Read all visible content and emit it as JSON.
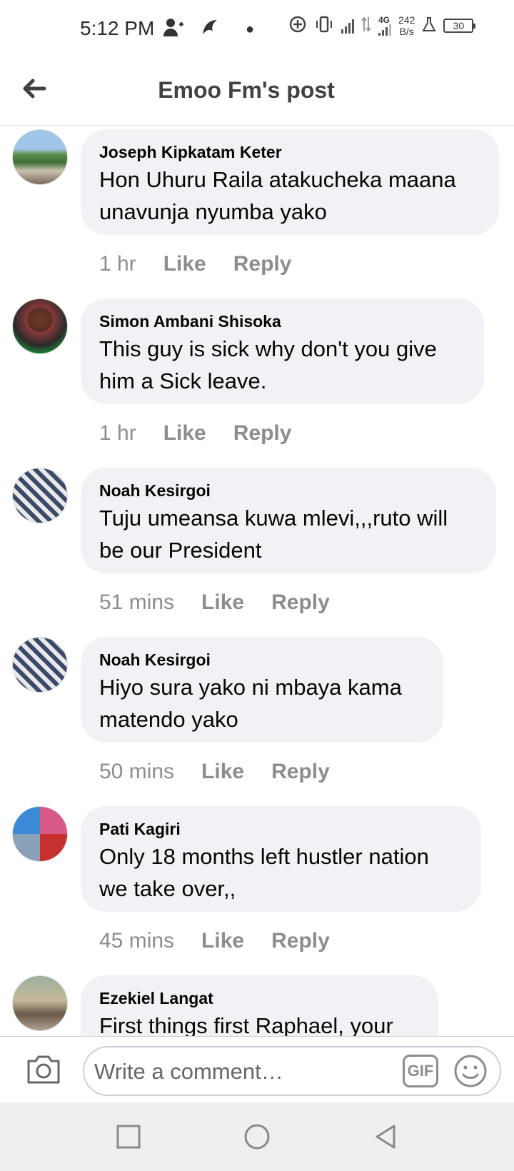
{
  "status_bar": {
    "time": "5:12 PM",
    "network_type": "4G",
    "net_rate_value": "242",
    "net_rate_unit": "B/s",
    "battery": "30"
  },
  "header": {
    "title": "Emoo Fm's post"
  },
  "comments": [
    {
      "author": "Joseph Kipkatam Keter",
      "text": "Hon Uhuru Raila atakucheka maana unavunja nyumba  yako",
      "time": "1 hr",
      "like": "Like",
      "reply": "Reply"
    },
    {
      "author": "Simon Ambani Shisoka",
      "text": "This guy is sick why don't you give him a Sick leave.",
      "time": "1 hr",
      "like": "Like",
      "reply": "Reply"
    },
    {
      "author": "Noah Kesirgoi",
      "text": "Tuju umeansa kuwa mlevi,,,ruto will be our President",
      "time": "51 mins",
      "like": "Like",
      "reply": "Reply"
    },
    {
      "author": "Noah Kesirgoi",
      "text": "Hiyo sura yako ni mbaya kama matendo yako",
      "time": "50 mins",
      "like": "Like",
      "reply": "Reply"
    },
    {
      "author": "Pati Kagiri",
      "text": "Only 18 months left hustler nation we take over,,",
      "time": "45 mins",
      "like": "Like",
      "reply": "Reply"
    },
    {
      "author": "Ezekiel Langat",
      "text": "First things first Raphael, your",
      "time": "",
      "like": "",
      "reply": ""
    }
  ],
  "composer": {
    "placeholder": "Write a comment…",
    "gif_label": "GIF"
  },
  "colors": {
    "bubble": "#f0f2f5",
    "meta_text": "#8a8d91",
    "title": "#3e4246"
  }
}
